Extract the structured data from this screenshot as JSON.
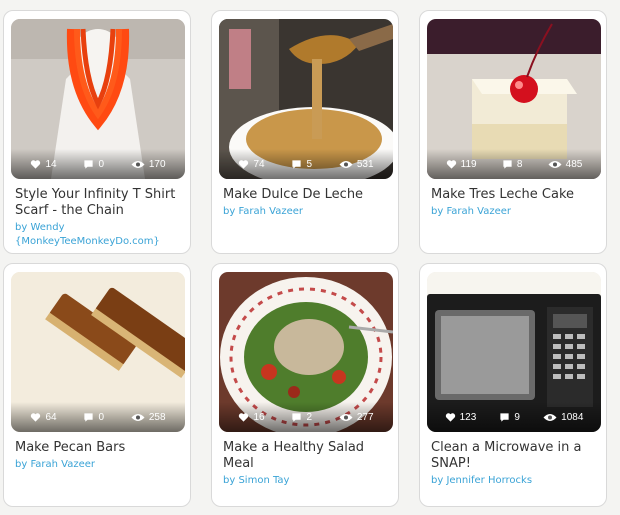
{
  "cards": [
    {
      "title": "Style Your Infinity T Shirt Scarf - the Chain",
      "by": "by",
      "author": "Wendy {MonkeyTeeMonkeyDo.com}",
      "favorites": "14",
      "comments": "0",
      "views": "170"
    },
    {
      "title": "Make Dulce De Leche",
      "by": "by",
      "author": "Farah Vazeer",
      "favorites": "74",
      "comments": "5",
      "views": "531"
    },
    {
      "title": "Make Tres Leche Cake",
      "by": "by",
      "author": "Farah Vazeer",
      "favorites": "119",
      "comments": "8",
      "views": "485"
    },
    {
      "title": "Make Pecan Bars",
      "by": "by",
      "author": "Farah Vazeer",
      "favorites": "64",
      "comments": "0",
      "views": "258"
    },
    {
      "title": "Make a Healthy Salad Meal",
      "by": "by",
      "author": "Simon Tay",
      "favorites": "16",
      "comments": "2",
      "views": "277"
    },
    {
      "title": "Clean a Microwave in a SNAP!",
      "by": "by",
      "author": "Jennifer Horrocks",
      "favorites": "123",
      "comments": "9",
      "views": "1084"
    }
  ],
  "colors": {
    "author_link": "#3aa3d6",
    "title_text": "#333333",
    "card_border": "#d9d9d9"
  },
  "icons": {
    "favorites": "heart-icon",
    "comments": "comment-icon",
    "views": "eye-icon"
  }
}
